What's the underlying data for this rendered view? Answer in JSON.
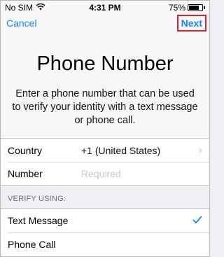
{
  "status_bar": {
    "carrier": "No SIM",
    "wifi_icon": "wifi-icon",
    "time": "4:31 PM",
    "battery_percent": "75%",
    "battery_level": 0.75
  },
  "nav": {
    "cancel_label": "Cancel",
    "next_label": "Next",
    "accent_color": "#1a82fb",
    "highlight_color": "#e0202a"
  },
  "main": {
    "title": "Phone Number",
    "description": "Enter a phone number that can be used to verify your identity with a text message or phone call."
  },
  "form": {
    "country_label": "Country",
    "country_value": "+1 (United States)",
    "number_label": "Number",
    "number_placeholder": "Required"
  },
  "verify": {
    "header": "VERIFY USING:",
    "options": [
      {
        "label": "Text Message",
        "selected": true
      },
      {
        "label": "Phone Call",
        "selected": false
      }
    ]
  }
}
